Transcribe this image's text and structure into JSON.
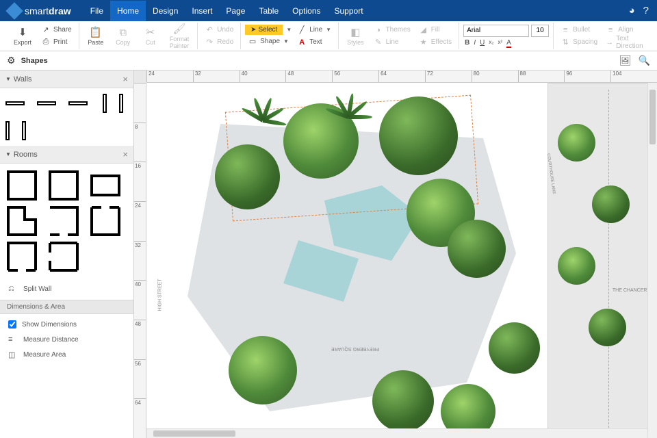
{
  "app": {
    "brand1": "smart",
    "brand2": "draw"
  },
  "menu": [
    "File",
    "Home",
    "Design",
    "Insert",
    "Page",
    "Table",
    "Options",
    "Support"
  ],
  "menu_active": 1,
  "ribbon": {
    "export": "Export",
    "share": "Share",
    "print": "Print",
    "paste": "Paste",
    "copy": "Copy",
    "cut": "Cut",
    "format_painter": "Format Painter",
    "undo": "Undo",
    "redo": "Redo",
    "select": "Select",
    "shape": "Shape",
    "line": "Line",
    "text": "Text",
    "styles": "Styles",
    "themes": "Themes",
    "line2": "Line",
    "fill": "Fill",
    "effects": "Effects",
    "bullet": "Bullet",
    "spacing": "Spacing",
    "align": "Align",
    "text_direction": "Text Direction"
  },
  "font": {
    "name": "Arial",
    "size": "10"
  },
  "shapes_panel": {
    "title": "Shapes"
  },
  "panels": {
    "walls": "Walls",
    "rooms": "Rooms",
    "split_wall": "Split Wall",
    "dim_area": "Dimensions & Area",
    "show_dim": "Show Dimensions",
    "measure_dist": "Measure Distance",
    "measure_area": "Measure Area"
  },
  "ruler_h": [
    "24",
    "32",
    "40",
    "48",
    "56",
    "64",
    "72",
    "80",
    "88",
    "96",
    "104"
  ],
  "ruler_v": [
    "",
    "8",
    "16",
    "24",
    "32",
    "40",
    "48",
    "56",
    "64"
  ],
  "plan_labels": {
    "square": "FREYBERG SQUARE",
    "street": "HIGH STREET",
    "chancery": "THE CHANCERY",
    "courthouse": "COURTHOUSE LANE"
  }
}
